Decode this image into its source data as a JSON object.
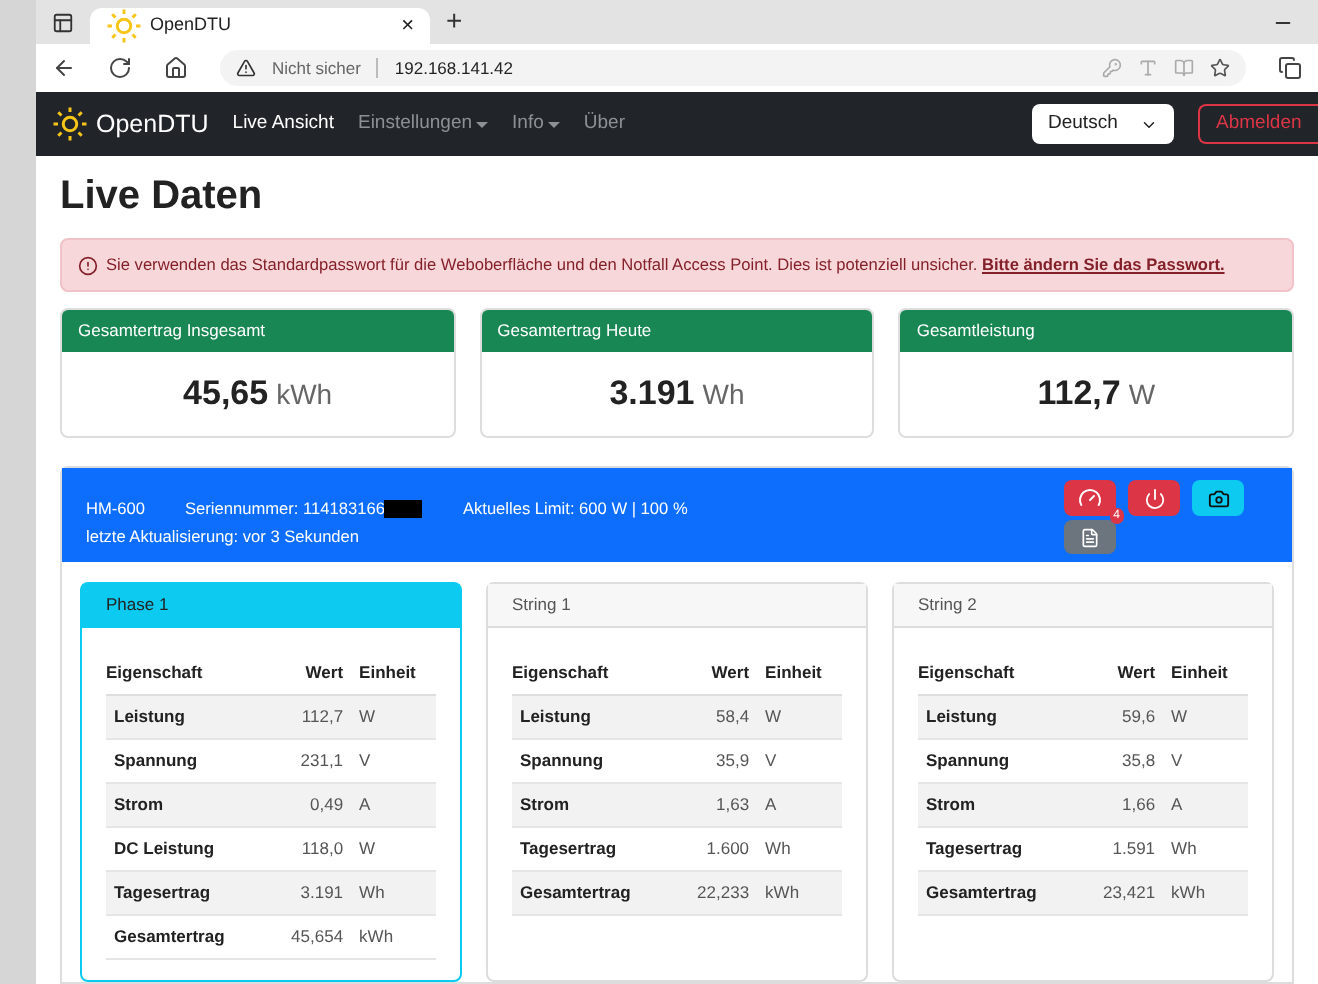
{
  "browser": {
    "tab_title": "OpenDTU",
    "tab_close": "×",
    "new_tab": "+",
    "security": "Nicht sicher",
    "address": "192.168.141.42"
  },
  "navbar": {
    "brand": "OpenDTU",
    "items": [
      {
        "label": "Live Ansicht",
        "selected": true,
        "dropdown": false
      },
      {
        "label": "Einstellungen",
        "selected": false,
        "dropdown": true
      },
      {
        "label": "Info",
        "selected": false,
        "dropdown": true
      },
      {
        "label": "Über",
        "selected": false,
        "dropdown": false
      }
    ],
    "language": "Deutsch",
    "logout": "Abmelden"
  },
  "page_title": "Live Daten",
  "alert": {
    "text": "Sie verwenden das Standardpasswort für die Weboberfläche und den Notfall Access Point. Dies ist potenziell unsicher.",
    "link": "Bitte ändern Sie das Passwort."
  },
  "totals": [
    {
      "title": "Gesamtertrag Insgesamt",
      "value": "45,65",
      "unit": "kWh"
    },
    {
      "title": "Gesamtertrag Heute",
      "value": "3.191",
      "unit": "Wh"
    },
    {
      "title": "Gesamtleistung",
      "value": "112,7",
      "unit": "W"
    }
  ],
  "inverter": {
    "model": "HM-600",
    "serial": "Seriennummer: 114183166",
    "limit": "Aktuelles Limit: 600 W | 100 %",
    "updated": "letzte Aktualisierung: vor 3 Sekunden",
    "limit_badge": "4"
  },
  "channels": [
    {
      "title": "Phase 1",
      "selected": true,
      "columns": [
        "Eigenschaft",
        "Wert",
        "Einheit"
      ],
      "rows": [
        [
          "Leistung",
          "112,7",
          "W"
        ],
        [
          "Spannung",
          "231,1",
          "V"
        ],
        [
          "Strom",
          "0,49",
          "A"
        ],
        [
          "DC Leistung",
          "118,0",
          "W"
        ],
        [
          "Tagesertrag",
          "3.191",
          "Wh"
        ],
        [
          "Gesamtertrag",
          "45,654",
          "kWh"
        ]
      ]
    },
    {
      "title": "String 1",
      "selected": false,
      "columns": [
        "Eigenschaft",
        "Wert",
        "Einheit"
      ],
      "rows": [
        [
          "Leistung",
          "58,4",
          "W"
        ],
        [
          "Spannung",
          "35,9",
          "V"
        ],
        [
          "Strom",
          "1,63",
          "A"
        ],
        [
          "Tagesertrag",
          "1.600",
          "Wh"
        ],
        [
          "Gesamtertrag",
          "22,233",
          "kWh"
        ]
      ]
    },
    {
      "title": "String 2",
      "selected": false,
      "columns": [
        "Eigenschaft",
        "Wert",
        "Einheit"
      ],
      "rows": [
        [
          "Leistung",
          "59,6",
          "W"
        ],
        [
          "Spannung",
          "35,8",
          "V"
        ],
        [
          "Strom",
          "1,66",
          "A"
        ],
        [
          "Tagesertrag",
          "1.591",
          "Wh"
        ],
        [
          "Gesamtertrag",
          "23,421",
          "kWh"
        ]
      ]
    }
  ]
}
